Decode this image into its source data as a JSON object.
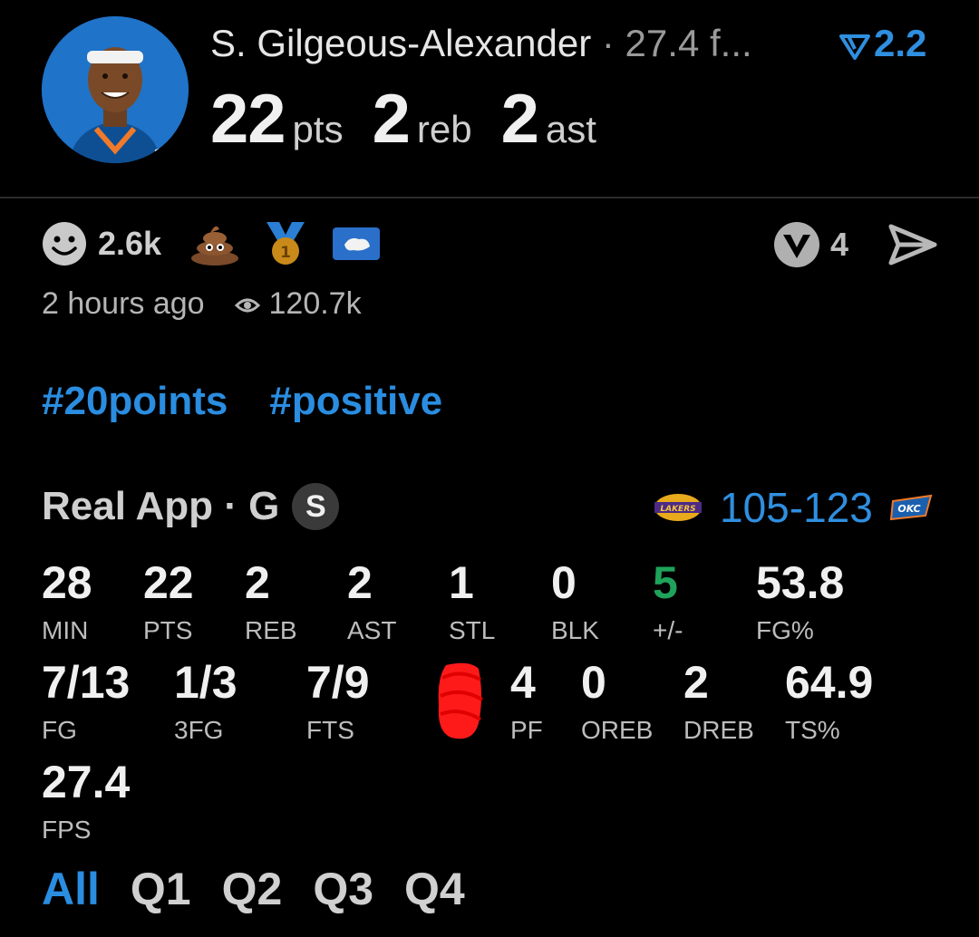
{
  "player": {
    "name": "S. Gilgeous-Alexander",
    "fantasy_points_short": "· 27.4 f...",
    "boost": "2.2",
    "pts": "22",
    "pts_unit": "pts",
    "reb": "2",
    "reb_unit": "reb",
    "ast": "2",
    "ast_unit": "ast",
    "team_logo_text": "OKC"
  },
  "reactions": {
    "smiley_count": "2.6k",
    "share_count": "4",
    "medal_label": "1"
  },
  "meta": {
    "posted": "2 hours ago",
    "views": "120.7k"
  },
  "tags": [
    "#20points",
    "#positive"
  ],
  "game": {
    "source": "Real App · G",
    "badge": "S",
    "score": "105-123",
    "away_logo_text": "LAKERS",
    "home_logo_text": "OKC"
  },
  "stats_row1": [
    {
      "value": "28",
      "label": "MIN"
    },
    {
      "value": "22",
      "label": "PTS"
    },
    {
      "value": "2",
      "label": "REB"
    },
    {
      "value": "2",
      "label": "AST"
    },
    {
      "value": "1",
      "label": "STL"
    },
    {
      "value": "0",
      "label": "BLK"
    },
    {
      "value": "5",
      "label": "+/-"
    },
    {
      "value": "53.8",
      "label": "FG%"
    }
  ],
  "stats_row2": [
    {
      "value": "7/13",
      "label": "FG"
    },
    {
      "value": "1/3",
      "label": "3FG"
    },
    {
      "value": "7/9",
      "label": "FTS"
    },
    {
      "value": "4",
      "label": "PF"
    },
    {
      "value": "0",
      "label": "OREB"
    },
    {
      "value": "2",
      "label": "DREB"
    },
    {
      "value": "64.9",
      "label": "TS%"
    }
  ],
  "stats_row3": [
    {
      "value": "27.4",
      "label": "FPS"
    }
  ],
  "quarter_tabs": [
    "All",
    "Q1",
    "Q2",
    "Q3",
    "Q4"
  ],
  "colors": {
    "accent": "#2a8de0",
    "positive": "#1fa35a",
    "background": "#000000",
    "redaction": "#ff1a1a"
  }
}
